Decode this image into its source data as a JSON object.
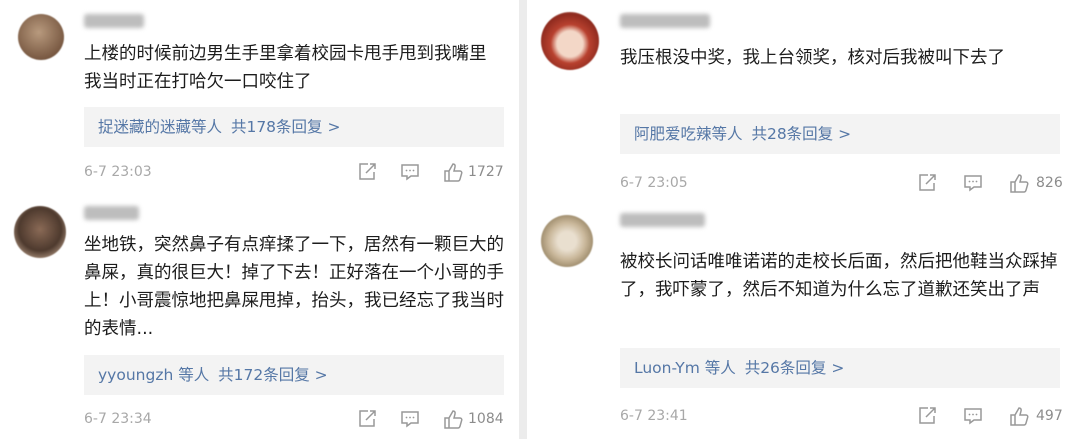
{
  "left": {
    "comments": [
      {
        "name": "",
        "text": "上楼的时候前边男生手里拿着校园卡甩手甩到我嘴里 我当时正在打哈欠一口咬住了",
        "reply_users": "捉迷藏的迷藏等人",
        "reply_total": "共178条回复 >",
        "time": "6-7 23:03",
        "likes": "1727"
      },
      {
        "name": "",
        "text": "坐地铁，突然鼻子有点痒揉了一下，居然有一颗巨大的鼻屎，真的很巨大！掉了下去！正好落在一个小哥的手上！小哥震惊地把鼻屎甩掉，抬头，我已经忘了我当时的表情...",
        "reply_users": "yyoungzh 等人",
        "reply_total": "共172条回复 >",
        "time": "6-7 23:34",
        "likes": "1084"
      }
    ]
  },
  "right": {
    "comments": [
      {
        "name": "",
        "text": "我压根没中奖，我上台领奖，核对后我被叫下去了",
        "reply_users": "阿肥爱吃辣等人",
        "reply_total": "共28条回复 >",
        "time": "6-7 23:05",
        "likes": "826"
      },
      {
        "name": "",
        "text": "被校长问话唯唯诺诺的走校长后面，然后把他鞋当众踩掉了，我吓蒙了，然后不知道为什么忘了道歉还笑出了声",
        "reply_users": "Luon-Ym 等人",
        "reply_total": "共26条回复 >",
        "time": "6-7 23:41",
        "likes": "497"
      }
    ]
  },
  "icons": {
    "share": "share-icon",
    "comment": "comment-icon",
    "like": "thumbs-up-icon"
  },
  "colors": {
    "link": "#5577a6",
    "reply_bg": "#f3f3f3",
    "meta": "#a8a8a8"
  }
}
